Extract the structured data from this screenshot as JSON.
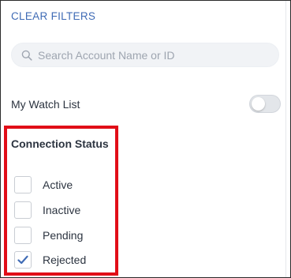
{
  "filters": {
    "clear_label": "CLEAR FILTERS",
    "search": {
      "placeholder": "Search Account Name or ID",
      "value": ""
    },
    "watch_list": {
      "label": "My Watch List",
      "enabled": false
    },
    "connection_status": {
      "heading": "Connection Status",
      "options": [
        {
          "label": "Active",
          "checked": false
        },
        {
          "label": "Inactive",
          "checked": false
        },
        {
          "label": "Pending",
          "checked": false
        },
        {
          "label": "Rejected",
          "checked": true
        }
      ]
    }
  },
  "colors": {
    "accent": "#3f6bb5",
    "highlight": "#e10d17",
    "checkmark": "#3f6bb5"
  },
  "icons": {
    "search": "search-icon",
    "check": "check-icon"
  }
}
